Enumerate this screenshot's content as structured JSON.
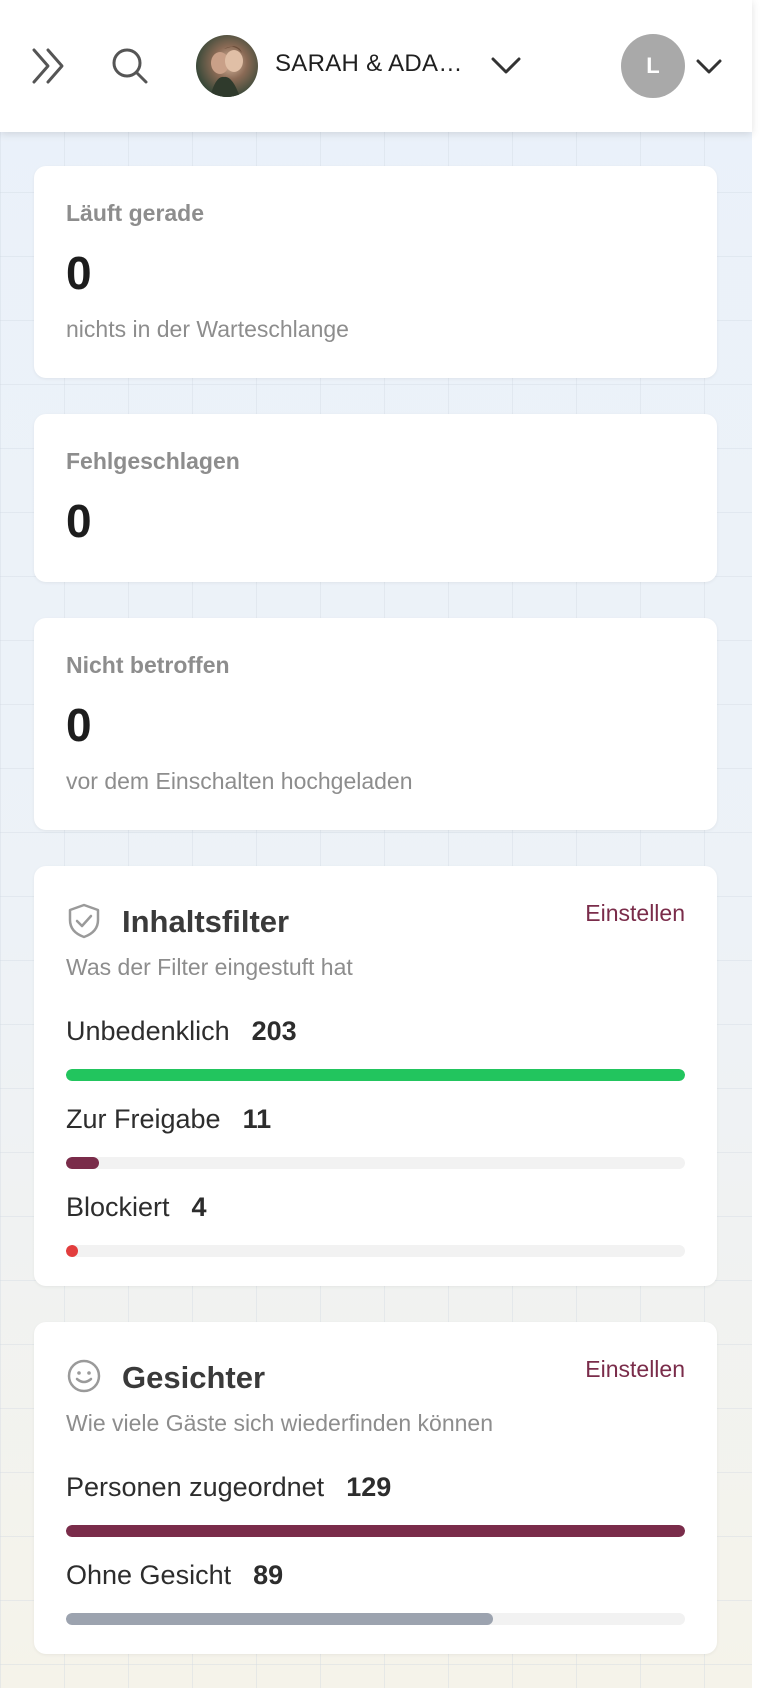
{
  "header": {
    "expand_icon": "double-chevron-right-icon",
    "search_icon": "search-icon",
    "event_name": "SARAH & ADAM…",
    "user_initial": "L"
  },
  "stats": [
    {
      "label": "Läuft gerade",
      "value": "0",
      "sub": "nichts in der Warteschlange"
    },
    {
      "label": "Fehlgeschlagen",
      "value": "0"
    },
    {
      "label": "Nicht betroffen",
      "value": "0",
      "sub": "vor dem Einschalten hochgeladen"
    }
  ],
  "content_filter": {
    "icon": "shield-check-icon",
    "title": "Inhaltsfilter",
    "action": "Einstellen",
    "subtitle": "Was der Filter eingestuft hat",
    "rows": [
      {
        "label": "Unbedenklich",
        "count": "203",
        "fraction": 1.0,
        "color": "#22c55e"
      },
      {
        "label": "Zur Freigabe",
        "count": "11",
        "fraction": 0.054,
        "color": "#7a2c4a"
      },
      {
        "label": "Blockiert",
        "count": "4",
        "fraction": 0.02,
        "color": "#e23d3d"
      }
    ]
  },
  "faces": {
    "icon": "smiley-icon",
    "title": "Gesichter",
    "action": "Einstellen",
    "subtitle": "Wie viele Gäste sich wiederfinden können",
    "rows": [
      {
        "label": "Personen zugeordnet",
        "count": "129",
        "fraction": 1.0,
        "color": "#7a2c4a"
      },
      {
        "label": "Ohne Gesicht",
        "count": "89",
        "fraction": 0.69,
        "color": "#9ca3af"
      }
    ]
  }
}
